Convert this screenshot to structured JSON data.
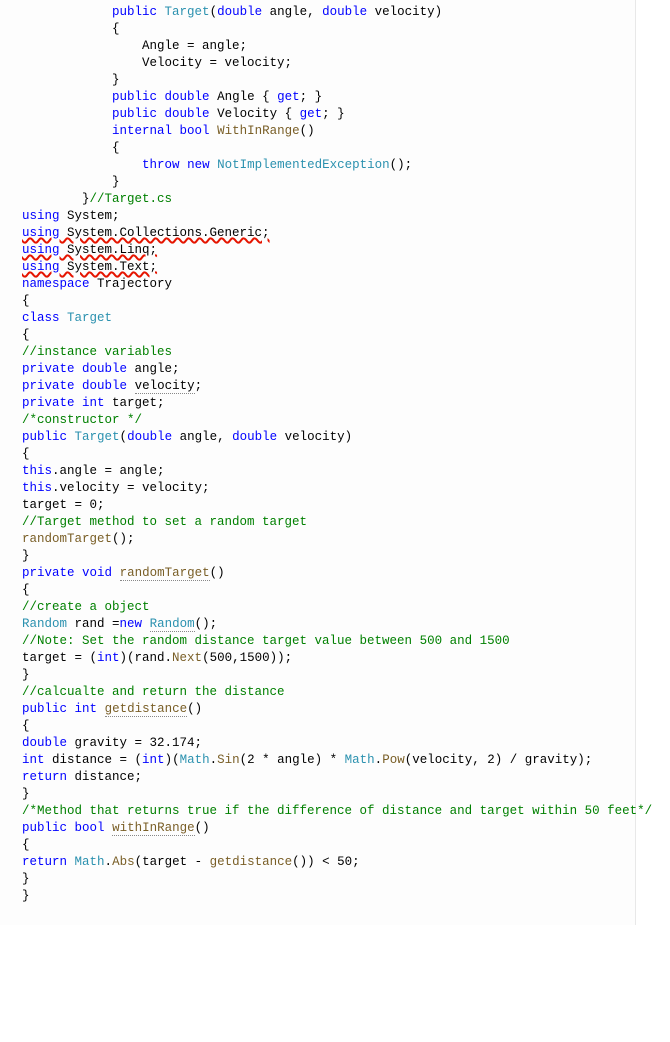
{
  "lines": [
    {
      "indent": 12,
      "tokens": [
        [
          "kw",
          "public"
        ],
        [
          "ident",
          " "
        ],
        [
          "type",
          "Target"
        ],
        [
          "ident",
          "("
        ],
        [
          "kw",
          "double"
        ],
        [
          "ident",
          " angle, "
        ],
        [
          "kw",
          "double"
        ],
        [
          "ident",
          " velocity)"
        ]
      ]
    },
    {
      "indent": 12,
      "tokens": [
        [
          "ident",
          "{"
        ]
      ]
    },
    {
      "indent": 16,
      "tokens": [
        [
          "ident",
          "Angle = angle;"
        ]
      ]
    },
    {
      "indent": 16,
      "tokens": [
        [
          "ident",
          "Velocity = velocity;"
        ]
      ]
    },
    {
      "indent": 12,
      "tokens": [
        [
          "ident",
          "}"
        ]
      ]
    },
    {
      "indent": 0,
      "tokens": []
    },
    {
      "indent": 12,
      "tokens": [
        [
          "kw",
          "public"
        ],
        [
          "ident",
          " "
        ],
        [
          "kw",
          "double"
        ],
        [
          "ident",
          " Angle { "
        ],
        [
          "kw",
          "get"
        ],
        [
          "ident",
          "; }"
        ]
      ]
    },
    {
      "indent": 12,
      "tokens": [
        [
          "kw",
          "public"
        ],
        [
          "ident",
          " "
        ],
        [
          "kw",
          "double"
        ],
        [
          "ident",
          " Velocity { "
        ],
        [
          "kw",
          "get"
        ],
        [
          "ident",
          "; }"
        ]
      ]
    },
    {
      "indent": 0,
      "tokens": []
    },
    {
      "indent": 12,
      "tokens": [
        [
          "kw",
          "internal"
        ],
        [
          "ident",
          " "
        ],
        [
          "kw",
          "bool"
        ],
        [
          "ident",
          " "
        ],
        [
          "method",
          "WithInRange"
        ],
        [
          "ident",
          "()"
        ]
      ]
    },
    {
      "indent": 12,
      "tokens": [
        [
          "ident",
          "{"
        ]
      ]
    },
    {
      "indent": 16,
      "tokens": [
        [
          "kw",
          "throw"
        ],
        [
          "ident",
          " "
        ],
        [
          "kw",
          "new"
        ],
        [
          "ident",
          " "
        ],
        [
          "type",
          "NotImplementedException"
        ],
        [
          "ident",
          "();"
        ]
      ]
    },
    {
      "indent": 12,
      "tokens": [
        [
          "ident",
          "}"
        ]
      ]
    },
    {
      "indent": 8,
      "tokens": [
        [
          "ident",
          "}"
        ],
        [
          "comment",
          "//Target.cs"
        ]
      ]
    },
    {
      "indent": 0,
      "tokens": [
        [
          "kw",
          "using"
        ],
        [
          "ident",
          " System;"
        ]
      ]
    },
    {
      "indent": 0,
      "squiggle": true,
      "tokens": [
        [
          "kw",
          "using"
        ],
        [
          "ident",
          " System.Collections.Generic;"
        ]
      ]
    },
    {
      "indent": 0,
      "squiggle": true,
      "tokens": [
        [
          "kw",
          "using"
        ],
        [
          "ident",
          " System.Linq;"
        ]
      ]
    },
    {
      "indent": 0,
      "squiggle": true,
      "tokens": [
        [
          "kw",
          "using"
        ],
        [
          "ident",
          " System.Text;"
        ]
      ]
    },
    {
      "indent": 0,
      "tokens": [
        [
          "kw",
          "namespace"
        ],
        [
          "ident",
          " Trajectory"
        ]
      ]
    },
    {
      "indent": 0,
      "tokens": [
        [
          "ident",
          "{"
        ]
      ]
    },
    {
      "indent": 0,
      "tokens": [
        [
          "kw",
          "class"
        ],
        [
          "ident",
          " "
        ],
        [
          "type",
          "Target"
        ]
      ]
    },
    {
      "indent": 0,
      "tokens": [
        [
          "ident",
          "{"
        ]
      ]
    },
    {
      "indent": 0,
      "tokens": [
        [
          "comment",
          "//instance variables"
        ]
      ]
    },
    {
      "indent": 0,
      "tokens": [
        [
          "kw",
          "private"
        ],
        [
          "ident",
          " "
        ],
        [
          "kw",
          "double"
        ],
        [
          "ident",
          " angle;"
        ]
      ]
    },
    {
      "indent": 0,
      "tokens": [
        [
          "kw",
          "private"
        ],
        [
          "ident",
          " "
        ],
        [
          "kw",
          "double"
        ],
        [
          "ident",
          " "
        ],
        [
          "ident dotted",
          "velocity"
        ],
        [
          "ident",
          ";"
        ]
      ]
    },
    {
      "indent": 0,
      "tokens": [
        [
          "kw",
          "private"
        ],
        [
          "ident",
          " "
        ],
        [
          "kw",
          "int"
        ],
        [
          "ident",
          " target;"
        ]
      ]
    },
    {
      "indent": 0,
      "tokens": [
        [
          "comment",
          "/*constructor */"
        ]
      ]
    },
    {
      "indent": 0,
      "tokens": [
        [
          "kw",
          "public"
        ],
        [
          "ident",
          " "
        ],
        [
          "type",
          "Target"
        ],
        [
          "ident",
          "("
        ],
        [
          "kw",
          "double"
        ],
        [
          "ident",
          " angle, "
        ],
        [
          "kw",
          "double"
        ],
        [
          "ident",
          " velocity)"
        ]
      ]
    },
    {
      "indent": 0,
      "tokens": [
        [
          "ident",
          "{"
        ]
      ]
    },
    {
      "indent": 0,
      "tokens": [
        [
          "kw",
          "this"
        ],
        [
          "ident",
          ".angle = angle;"
        ]
      ]
    },
    {
      "indent": 0,
      "tokens": [
        [
          "kw",
          "this"
        ],
        [
          "ident",
          ".velocity = velocity;"
        ]
      ]
    },
    {
      "indent": 0,
      "tokens": [
        [
          "ident",
          "target = 0;"
        ]
      ]
    },
    {
      "indent": 0,
      "tokens": [
        [
          "comment",
          "//Target method to set a random target"
        ]
      ]
    },
    {
      "indent": 0,
      "tokens": [
        [
          "method",
          "randomTarget"
        ],
        [
          "ident",
          "();"
        ]
      ]
    },
    {
      "indent": 0,
      "tokens": [
        [
          "ident",
          "}"
        ]
      ]
    },
    {
      "indent": 0,
      "tokens": [
        [
          "kw",
          "private"
        ],
        [
          "ident",
          " "
        ],
        [
          "kw",
          "void"
        ],
        [
          "ident",
          " "
        ],
        [
          "method dotted",
          "randomTarget"
        ],
        [
          "ident",
          "()"
        ]
      ]
    },
    {
      "indent": 0,
      "tokens": [
        [
          "ident",
          "{"
        ]
      ]
    },
    {
      "indent": 0,
      "tokens": []
    },
    {
      "indent": 0,
      "tokens": [
        [
          "comment",
          "//create a object"
        ]
      ]
    },
    {
      "indent": 0,
      "tokens": [
        [
          "type",
          "Random"
        ],
        [
          "ident",
          " rand ="
        ],
        [
          "kw",
          "new"
        ],
        [
          "ident",
          " "
        ],
        [
          "type dotted",
          "Random"
        ],
        [
          "ident",
          "();"
        ]
      ]
    },
    {
      "indent": 0,
      "tokens": []
    },
    {
      "indent": 0,
      "tokens": [
        [
          "comment",
          "//Note: Set the random distance target value between 500 and 1500"
        ]
      ]
    },
    {
      "indent": 0,
      "tokens": [
        [
          "ident",
          "target = ("
        ],
        [
          "kw",
          "int"
        ],
        [
          "ident",
          ")(rand."
        ],
        [
          "method",
          "Next"
        ],
        [
          "ident",
          "(500,1500));"
        ]
      ]
    },
    {
      "indent": 0,
      "tokens": [
        [
          "ident",
          "}"
        ]
      ]
    },
    {
      "indent": 0,
      "tokens": [
        [
          "comment",
          "//calcualte and return the distance"
        ]
      ]
    },
    {
      "indent": 0,
      "tokens": [
        [
          "kw",
          "public"
        ],
        [
          "ident",
          " "
        ],
        [
          "kw",
          "int"
        ],
        [
          "ident",
          " "
        ],
        [
          "method dotted",
          "getdistance"
        ],
        [
          "ident",
          "()"
        ]
      ]
    },
    {
      "indent": 0,
      "tokens": [
        [
          "ident",
          "{"
        ]
      ]
    },
    {
      "indent": 0,
      "tokens": [
        [
          "kw",
          "double"
        ],
        [
          "ident",
          " gravity = 32.174;"
        ]
      ]
    },
    {
      "indent": 0,
      "tokens": [
        [
          "kw",
          "int"
        ],
        [
          "ident",
          " distance = ("
        ],
        [
          "kw",
          "int"
        ],
        [
          "ident",
          ")("
        ],
        [
          "type",
          "Math"
        ],
        [
          "ident",
          "."
        ],
        [
          "method",
          "Sin"
        ],
        [
          "ident",
          "(2 * angle) * "
        ],
        [
          "type",
          "Math"
        ],
        [
          "ident",
          "."
        ],
        [
          "method",
          "Pow"
        ],
        [
          "ident",
          "(velocity, 2) / gravity);"
        ]
      ]
    },
    {
      "indent": 0,
      "tokens": [
        [
          "kw",
          "return"
        ],
        [
          "ident",
          " distance;"
        ]
      ]
    },
    {
      "indent": 0,
      "tokens": [
        [
          "ident",
          "}"
        ]
      ]
    },
    {
      "indent": 0,
      "tokens": [
        [
          "comment",
          "/*Method that returns true if the difference of distance and target within 50 feet*/"
        ]
      ]
    },
    {
      "indent": 0,
      "tokens": [
        [
          "kw",
          "public"
        ],
        [
          "ident",
          " "
        ],
        [
          "kw",
          "bool"
        ],
        [
          "ident",
          " "
        ],
        [
          "method dotted",
          "withInRange"
        ],
        [
          "ident",
          "()"
        ]
      ]
    },
    {
      "indent": 0,
      "tokens": [
        [
          "ident",
          "{"
        ]
      ]
    },
    {
      "indent": 0,
      "tokens": [
        [
          "kw",
          "return"
        ],
        [
          "ident",
          " "
        ],
        [
          "type",
          "Math"
        ],
        [
          "ident",
          "."
        ],
        [
          "method",
          "Abs"
        ],
        [
          "ident",
          "(target - "
        ],
        [
          "method",
          "getdistance"
        ],
        [
          "ident",
          "()) < 50;"
        ]
      ]
    },
    {
      "indent": 0,
      "tokens": [
        [
          "ident",
          "}"
        ]
      ]
    },
    {
      "indent": 0,
      "tokens": [
        [
          "ident",
          "}"
        ]
      ]
    }
  ]
}
